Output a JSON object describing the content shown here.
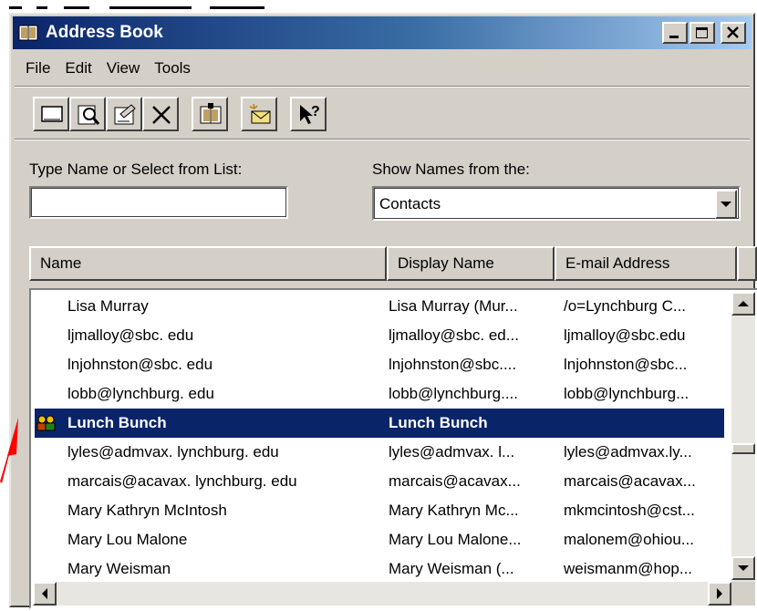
{
  "window": {
    "title": "Address Book",
    "icon": "address-book-icon",
    "controls": [
      "minimize-icon",
      "maximize-icon",
      "close-icon"
    ]
  },
  "menu": [
    "File",
    "Edit",
    "View",
    "Tools"
  ],
  "toolbar": {
    "icons": [
      "new-entry-icon",
      "find-people-icon",
      "properties-icon",
      "delete-icon",
      "address-book-open-icon",
      "new-message-icon",
      "whats-this-help-icon"
    ]
  },
  "search": {
    "label": "Type Name or Select from List:",
    "value": ""
  },
  "show_names": {
    "label": "Show Names from the:",
    "value": "Contacts"
  },
  "list": {
    "columns": [
      "Name",
      "Display Name",
      "E-mail Address",
      ""
    ],
    "rows": [
      {
        "name": "Lisa Murray",
        "display": "Lisa Murray (Mur...",
        "email": "/o=Lynchburg C...",
        "icon": "",
        "selected": false
      },
      {
        "name": "ljmalloy@sbc. edu",
        "display": "ljmalloy@sbc. ed...",
        "email": "ljmalloy@sbc.edu",
        "icon": "",
        "selected": false
      },
      {
        "name": "lnjohnston@sbc. edu",
        "display": "lnjohnston@sbc....",
        "email": "lnjohnston@sbc...",
        "icon": "",
        "selected": false
      },
      {
        "name": "lobb@lynchburg. edu",
        "display": "lobb@lynchburg....",
        "email": "lobb@lynchburg...",
        "icon": "",
        "selected": false
      },
      {
        "name": "Lunch Bunch",
        "display": "Lunch Bunch",
        "email": "",
        "icon": "group-icon",
        "selected": true
      },
      {
        "name": "lyles@admvax. lynchburg. edu",
        "display": "lyles@admvax. l...",
        "email": "lyles@admvax.ly...",
        "icon": "",
        "selected": false
      },
      {
        "name": "marcais@acavax. lynchburg. edu",
        "display": "marcais@acavax...",
        "email": "marcais@acavax...",
        "icon": "",
        "selected": false
      },
      {
        "name": "Mary Kathryn McIntosh",
        "display": "Mary Kathryn Mc...",
        "email": "mkmcintosh@cst...",
        "icon": "",
        "selected": false
      },
      {
        "name": "Mary Lou Malone",
        "display": "Mary Lou Malone...",
        "email": "malonem@ohiou...",
        "icon": "",
        "selected": false
      },
      {
        "name": "Mary Weisman",
        "display": "Mary Weisman (...",
        "email": "weismanm@hop...",
        "icon": "",
        "selected": false
      }
    ]
  },
  "colors": {
    "face": "#d4d0c8",
    "title_dark": "#0a246a",
    "title_light": "#a6caf0",
    "selection": "#0a246a",
    "annotation_arrow": "#ff0000"
  }
}
